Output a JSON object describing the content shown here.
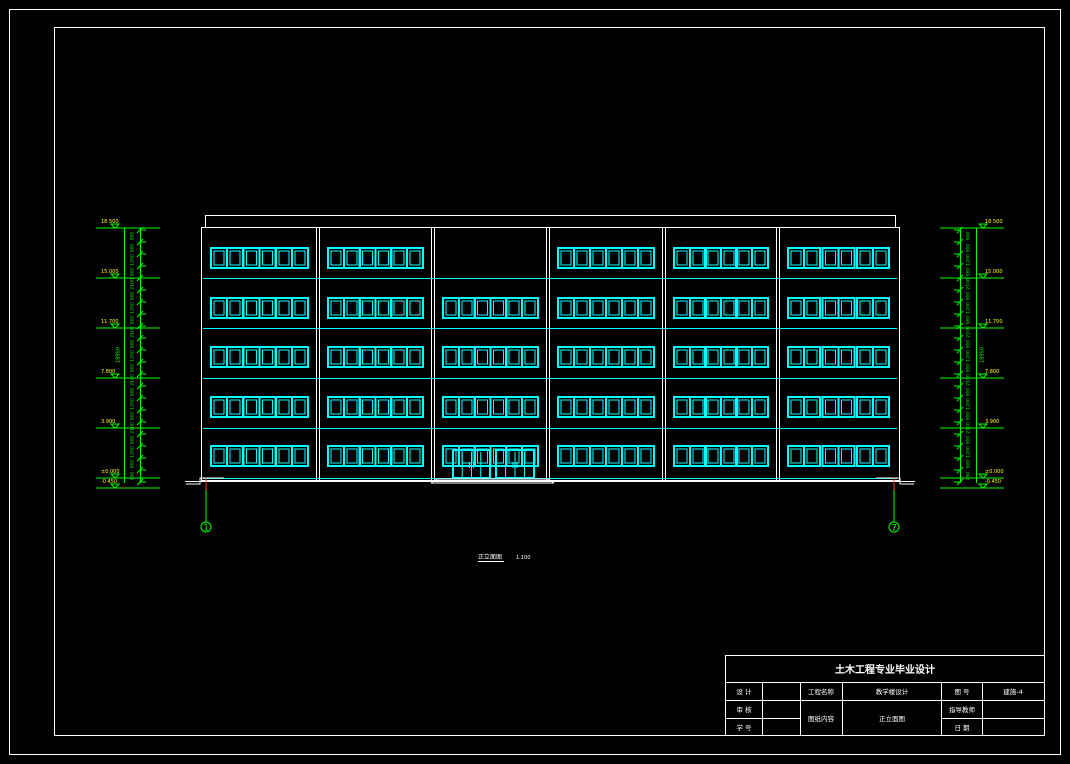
{
  "colors": {
    "background": "#000000",
    "frame": "#ffffff",
    "windows": "#00ffff",
    "dimensions": "#00ff00",
    "elevation_text": "#ffff00",
    "axis_line": "#ff3030"
  },
  "drawing": {
    "caption": "正立面图",
    "scale": "1:100",
    "axes": {
      "left": "1",
      "right": "7"
    },
    "floors": 5,
    "bays": 6
  },
  "elevations": {
    "left": [
      "18.500",
      "15.000",
      "11.700",
      "7.800",
      "3.900",
      "±0.000",
      "-0.450"
    ],
    "right": [
      "18.500",
      "15.000",
      "11.700",
      "7.800",
      "3.900",
      "±0.000",
      "-0.450"
    ]
  },
  "dimensions": {
    "left_segments": [
      "900",
      "900",
      "1200",
      "900",
      "2100",
      "900",
      "1200",
      "900",
      "2100",
      "900",
      "1200",
      "900",
      "2100",
      "900",
      "1200",
      "900",
      "2100",
      "900",
      "1200",
      "900",
      "450"
    ],
    "left_total": "18950",
    "right_segments": [
      "900",
      "900",
      "1200",
      "900",
      "2100",
      "900",
      "1200",
      "900",
      "2100",
      "900",
      "1200",
      "900",
      "2100",
      "900",
      "1200",
      "900",
      "2100",
      "900",
      "1200",
      "900",
      "450"
    ],
    "right_total": "18950"
  },
  "title_block": {
    "heading": "土木工程专业毕业设计",
    "design_label": "设 计",
    "review_label": "审 核",
    "student_id_label": "学 号",
    "project_name_label": "工程名称",
    "project_name": "教学楼设计",
    "drawing_content_label": "图纸内容",
    "drawing_content": "正立面图",
    "drawing_no_label": "图 号",
    "drawing_no": "建施-4",
    "advisor_label": "指导教师",
    "date_label": "日 期"
  }
}
